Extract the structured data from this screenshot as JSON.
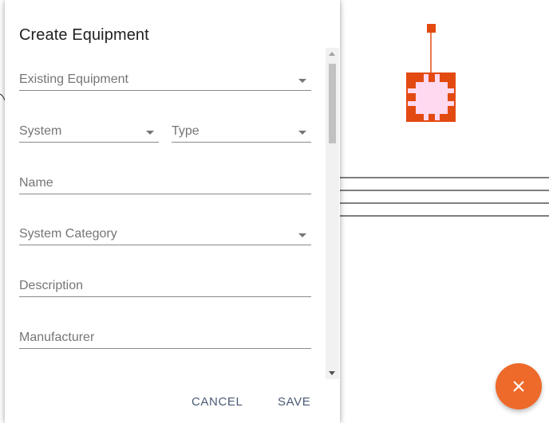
{
  "dialog": {
    "title": "Create Equipment",
    "fields": {
      "existing_equipment": "Existing Equipment",
      "system": "System",
      "type": "Type",
      "name": "Name",
      "system_category": "System Category",
      "description": "Description",
      "manufacturer": "Manufacturer"
    },
    "actions": {
      "cancel": "CANCEL",
      "save": "SAVE"
    }
  },
  "colors": {
    "fab": "#ee6a2a",
    "equipment_node_border": "#e34a12",
    "equipment_node_fill": "#ffd9ef",
    "action_text": "#4b5a76"
  },
  "icons": {
    "fab": "close-icon",
    "dropdown": "chevron-down-icon"
  }
}
